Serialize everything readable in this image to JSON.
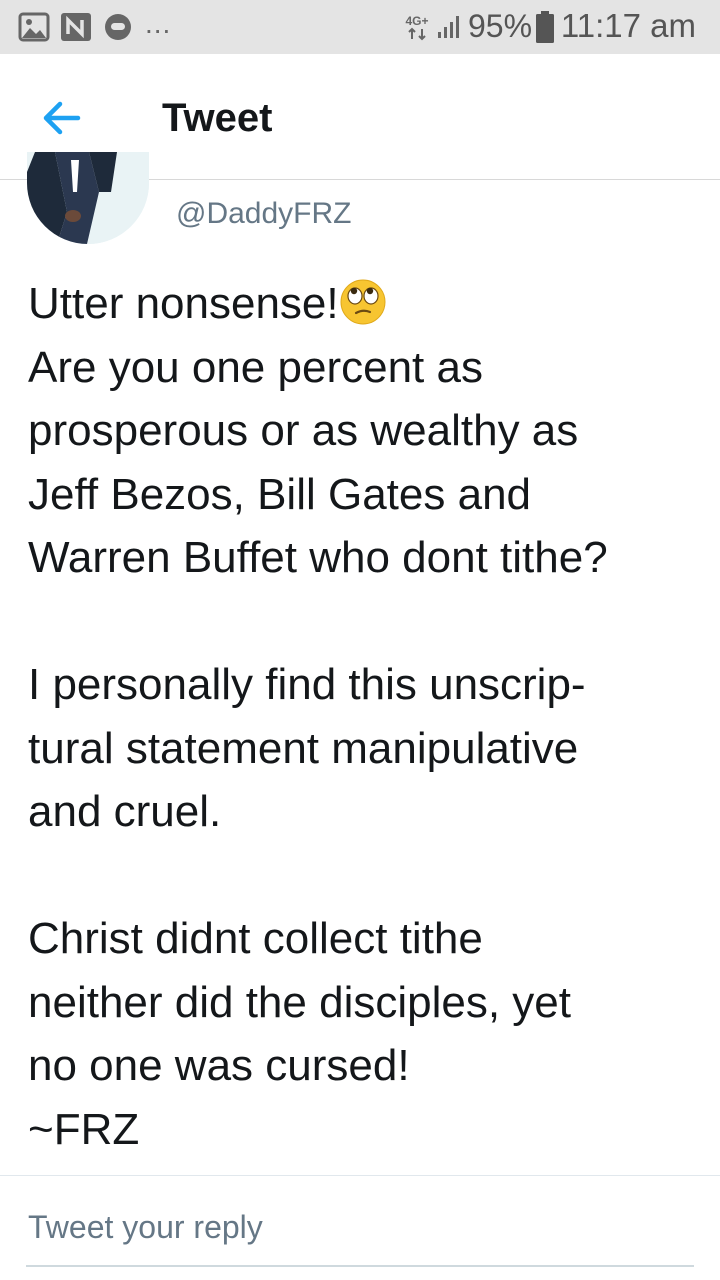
{
  "status_bar": {
    "icons": [
      "image-icon",
      "nfc-icon",
      "chat-icon"
    ],
    "overflow": "...",
    "network": "4G+",
    "battery_percent": "95%",
    "time": "11:17 am"
  },
  "app_bar": {
    "back_icon": "arrow-left-icon",
    "title": "Tweet"
  },
  "tweet": {
    "handle": "@DaddyFRZ",
    "lines": [
      "Utter nonsense!",
      "Are you one percent as",
      "prosperous or as wealthy as",
      "Jeff Bezos, Bill Gates and",
      "Warren Buffet who dont tithe?",
      "",
      "I personally find this unscrip-",
      "tural statement manipulative",
      "and cruel.",
      "",
      "Christ didnt collect tithe",
      "neither did the disciples, yet",
      "no one was cursed!",
      "~FRZ"
    ],
    "emoji": "face-with-rolling-eyes"
  },
  "reply": {
    "placeholder": "Tweet your reply"
  },
  "colors": {
    "accent": "#1da1f2",
    "text": "#14171a",
    "secondary": "#657786",
    "status_bar_bg": "#e4e4e4"
  }
}
